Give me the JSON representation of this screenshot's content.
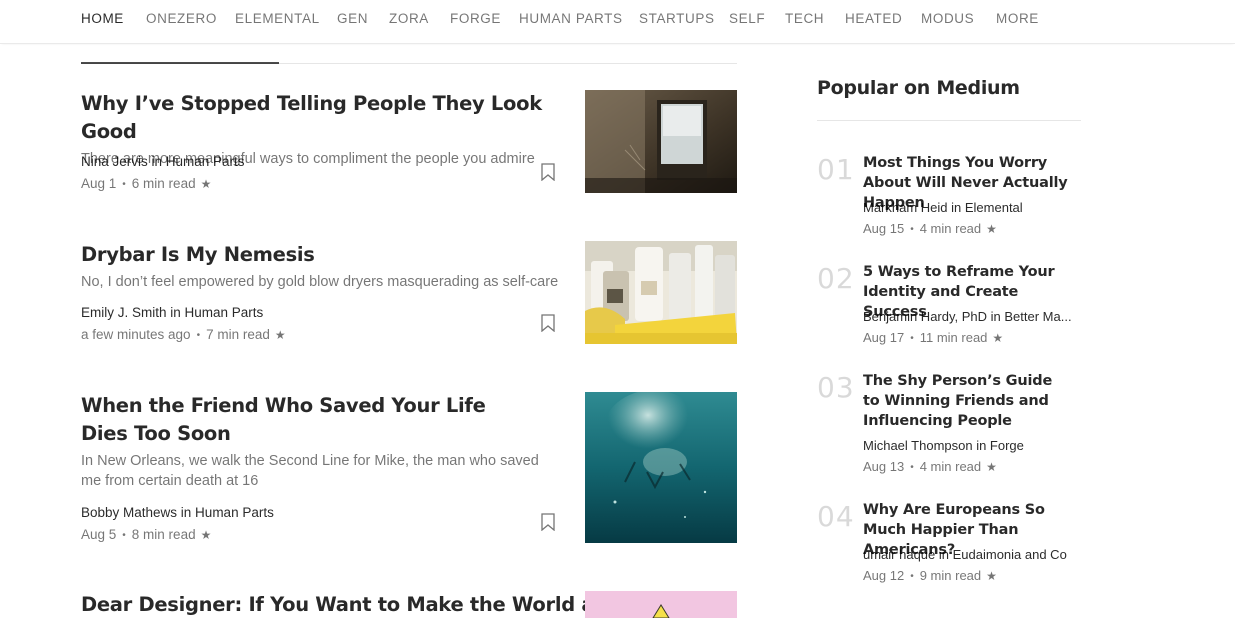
{
  "nav": [
    "HOME",
    "ONEZERO",
    "ELEMENTAL",
    "GEN",
    "ZORA",
    "FORGE",
    "HUMAN PARTS",
    "STARTUPS",
    "SELF",
    "TECH",
    "HEATED",
    "MODUS",
    "MORE"
  ],
  "articles": [
    {
      "title": "Why I’ve Stopped Telling People They Look Good",
      "subtitle": "There are more meaningful ways to compliment the people you admire",
      "author": "Nina Jervis in Human Parts",
      "date": "Aug 1",
      "read": "6 min read",
      "star": "★",
      "thumb_icon": "window-photo"
    },
    {
      "title": "Drybar Is My Nemesis",
      "subtitle": "No, I don’t feel empowered by gold blow dryers masquerading as self-care",
      "author": "Emily J. Smith in Human Parts",
      "date": "a few minutes ago",
      "read": "7 min read",
      "star": "★",
      "thumb_icon": "bottles-photo"
    },
    {
      "title": "When the Friend Who Saved Your Life Dies Too Soon",
      "subtitle": "In New Orleans, we walk the Second Line for Mike, the man who saved me from certain death at 16",
      "author": "Bobby Mathews in Human Parts",
      "date": "Aug 5",
      "read": "8 min read",
      "star": "★",
      "thumb_icon": "underwater-photo"
    },
    {
      "title": "Dear Designer: If You Want to Make the World a",
      "thumb_icon": "pink-illustration"
    }
  ],
  "sidebar": {
    "title": "Popular on Medium",
    "items": [
      {
        "num": "01",
        "title": "Most Things You Worry About Will Never Actually Happen",
        "author": "Markham Heid in Elemental",
        "date": "Aug 15",
        "read": "4 min read",
        "star": "★"
      },
      {
        "num": "02",
        "title": "5 Ways to Reframe Your Identity and Create Success",
        "author": "Benjamin Hardy, PhD in Better Ma...",
        "date": "Aug 17",
        "read": "11 min read",
        "star": "★"
      },
      {
        "num": "03",
        "title": "The Shy Person’s Guide to Winning Friends and Influencing People",
        "author": "Michael Thompson in Forge",
        "date": "Aug 13",
        "read": "4 min read",
        "star": "★"
      },
      {
        "num": "04",
        "title": "Why Are Europeans So Much Happier Than Americans?",
        "author": "umair haque in Eudaimonia and Co",
        "date": "Aug 12",
        "read": "9 min read",
        "star": "★"
      }
    ]
  },
  "colors": {
    "text": "#292929",
    "muted": "#757575",
    "rule": "#e6e6e6",
    "number": "#d9d9d9"
  }
}
